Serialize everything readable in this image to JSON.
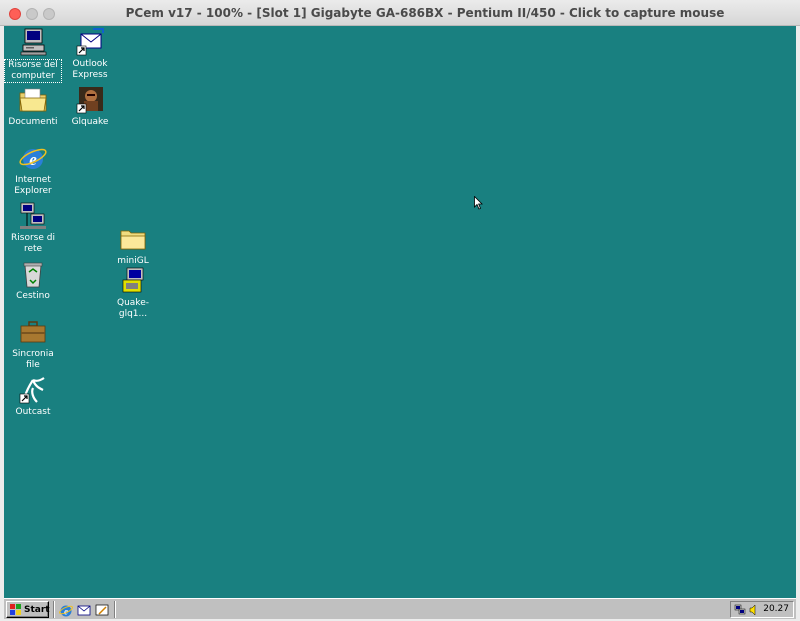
{
  "window": {
    "title": "PCem v17 - 100% - [Slot 1] Gigabyte GA-686BX - Pentium II/450 - Click to capture mouse"
  },
  "desktop": {
    "background": "#198080",
    "icons": [
      {
        "label": "Risorse del computer",
        "icon": "my-computer-icon"
      },
      {
        "label": "Outlook Express",
        "icon": "outlook-express-icon"
      },
      {
        "label": "Documenti",
        "icon": "my-documents-icon"
      },
      {
        "label": "Glquake",
        "icon": "glquake-icon"
      },
      {
        "label": "Internet Explorer",
        "icon": "internet-explorer-icon"
      },
      {
        "label": "Risorse di rete",
        "icon": "network-neighborhood-icon"
      },
      {
        "label": "miniGL",
        "icon": "folder-icon"
      },
      {
        "label": "Quake-glq1...",
        "icon": "quake-setup-icon"
      },
      {
        "label": "Cestino",
        "icon": "recycle-bin-icon"
      },
      {
        "label": "Sincronia file",
        "icon": "briefcase-icon"
      },
      {
        "label": "Outcast",
        "icon": "outcast-icon"
      }
    ]
  },
  "taskbar": {
    "start_label": "Start",
    "quick_launch": [
      "internet-explorer-icon",
      "outlook-express-icon",
      "show-desktop-icon"
    ],
    "tray": {
      "icons": [
        "network-tray-icon",
        "volume-icon"
      ],
      "clock": "20.27"
    }
  }
}
